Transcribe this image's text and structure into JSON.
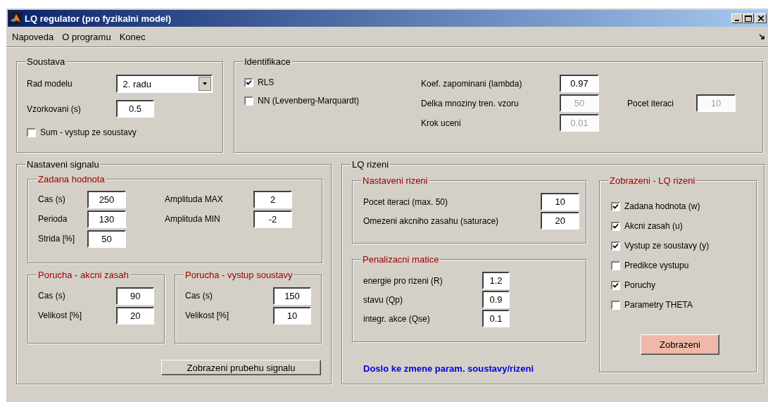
{
  "window": {
    "title": "LQ regulator (pro fyzikalni model)"
  },
  "menu": [
    "Napoveda",
    "O programu",
    "Konec"
  ],
  "soustava": {
    "title": "Soustava",
    "rad_modelu": {
      "label": "Rad modelu",
      "value": "2. radu"
    },
    "vzorkovani": {
      "label": "Vzorkovani (s)",
      "value": "0.5"
    },
    "sum": {
      "label": "Sum - vystup ze soustavy",
      "checked": false
    }
  },
  "identifikace": {
    "title": "Identifikace",
    "methods": [
      {
        "label": "RLS",
        "checked": true
      },
      {
        "label": "NN (Levenberg-Marquardt)",
        "checked": false
      }
    ],
    "params": [
      {
        "label": "Koef. zapominani (lambda)",
        "value": "0.97",
        "disabled": false
      },
      {
        "label": "Delka mnoziny tren. vzoru",
        "value": "50",
        "disabled": true
      },
      {
        "label": "Krok uceni",
        "value": "0.01",
        "disabled": true
      }
    ],
    "iterations": {
      "label": "Pocet iteraci",
      "value": "10",
      "disabled": true
    }
  },
  "nastaveni_signalu": {
    "title": "Nastaveni signalu",
    "zadana_hodnota": {
      "title": "Zadana hodnota",
      "columns": [
        [
          {
            "label": "Cas (s)",
            "value": "250"
          },
          {
            "label": "Perioda",
            "value": "130"
          },
          {
            "label": "Strida [%]",
            "value": "50"
          }
        ],
        [
          {
            "label": "Amplituda MAX",
            "value": "2"
          },
          {
            "label": "Amplituda MIN",
            "value": "-2"
          }
        ]
      ]
    },
    "poruchy": [
      {
        "title": "Porucha - akcni zasah",
        "fields": [
          {
            "label": "Cas (s)",
            "value": "90"
          },
          {
            "label": "Velikost [%]",
            "value": "20"
          }
        ]
      },
      {
        "title": "Porucha - vystup soustavy",
        "fields": [
          {
            "label": "Cas (s)",
            "value": "150"
          },
          {
            "label": "Velikost [%]",
            "value": "10"
          }
        ]
      }
    ],
    "button": "Zobrazeni prubehu signalu"
  },
  "lq_rizeni": {
    "title": "LQ rizeni",
    "nastaveni_rizeni": {
      "title": "Nastaveni rizeni",
      "fields": [
        {
          "label": "Pocet iteraci (max. 50)",
          "value": "10"
        },
        {
          "label": "Omezeni akcniho zasahu (saturace)",
          "value": "20"
        }
      ]
    },
    "penalizacni_matice": {
      "title": "Penalizacni matice",
      "fields": [
        {
          "label": "energie pro rizeni (R)",
          "value": "1.2"
        },
        {
          "label": "stavu (Qp)",
          "value": "0.9"
        },
        {
          "label": "integr. akce (Qse)",
          "value": "0.1"
        }
      ]
    },
    "status": "Doslo ke zmene param. soustavy/rizeni",
    "zobrazeni": {
      "title": "Zobrazeni - LQ rizeni",
      "options": [
        {
          "label": "Zadana hodnota (w)",
          "checked": true
        },
        {
          "label": "Akcni zasah (u)",
          "checked": true
        },
        {
          "label": "Vystup ze soustavy (y)",
          "checked": true
        },
        {
          "label": "Predikce vystupu",
          "checked": false
        },
        {
          "label": "Poruchy",
          "checked": true
        },
        {
          "label": "Parametry THETA",
          "checked": false
        }
      ],
      "button": "Zobrazeni"
    }
  }
}
